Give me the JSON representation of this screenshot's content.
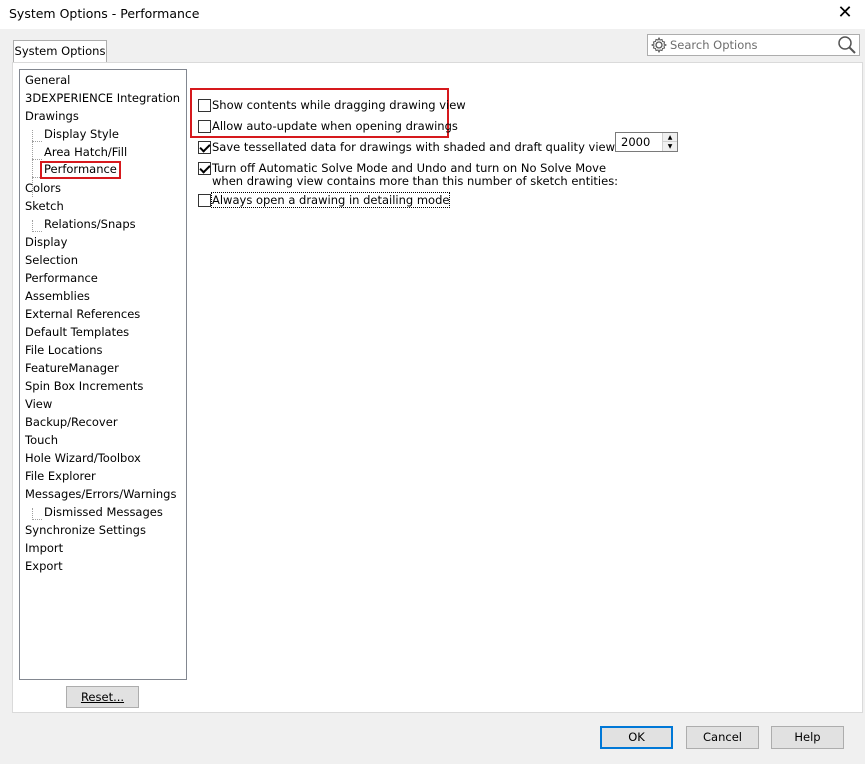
{
  "window": {
    "title": "System Options - Performance",
    "close_glyph": "✕"
  },
  "tab": {
    "label": "System Options"
  },
  "search": {
    "placeholder": "Search Options"
  },
  "tree": {
    "items": [
      {
        "label": "General",
        "level": 0
      },
      {
        "label": "3DEXPERIENCE Integration",
        "level": 0
      },
      {
        "label": "Drawings",
        "level": 0
      },
      {
        "label": "Display Style",
        "level": 1
      },
      {
        "label": "Area Hatch/Fill",
        "level": 1
      },
      {
        "label": "Performance",
        "level": 1,
        "selected": true
      },
      {
        "label": "Colors",
        "level": 0
      },
      {
        "label": "Sketch",
        "level": 0
      },
      {
        "label": "Relations/Snaps",
        "level": 1
      },
      {
        "label": "Display",
        "level": 0
      },
      {
        "label": "Selection",
        "level": 0
      },
      {
        "label": "Performance",
        "level": 0
      },
      {
        "label": "Assemblies",
        "level": 0
      },
      {
        "label": "External References",
        "level": 0
      },
      {
        "label": "Default Templates",
        "level": 0
      },
      {
        "label": "File Locations",
        "level": 0
      },
      {
        "label": "FeatureManager",
        "level": 0
      },
      {
        "label": "Spin Box Increments",
        "level": 0
      },
      {
        "label": "View",
        "level": 0
      },
      {
        "label": "Backup/Recover",
        "level": 0
      },
      {
        "label": "Touch",
        "level": 0
      },
      {
        "label": "Hole Wizard/Toolbox",
        "level": 0
      },
      {
        "label": "File Explorer",
        "level": 0
      },
      {
        "label": "Messages/Errors/Warnings",
        "level": 0
      },
      {
        "label": "Dismissed Messages",
        "level": 1
      },
      {
        "label": "Synchronize Settings",
        "level": 0
      },
      {
        "label": "Import",
        "level": 0
      },
      {
        "label": "Export",
        "level": 0
      }
    ],
    "reset_label": "Reset..."
  },
  "options": {
    "show_contents": {
      "label": "Show contents while dragging drawing view",
      "checked": false
    },
    "auto_update": {
      "label": "Allow auto-update when opening drawings",
      "checked": false
    },
    "save_tessellated": {
      "label": "Save tessellated data for drawings with shaded and draft quality views",
      "checked": true
    },
    "turn_off_solve": {
      "label_line1": "Turn off Automatic Solve Mode and Undo and turn on No Solve Move",
      "label_line2": "when drawing view contains more than this number of sketch entities:",
      "checked": true,
      "value": "2000"
    },
    "always_detailing": {
      "label": "Always open a drawing in detailing mode",
      "checked": false
    }
  },
  "buttons": {
    "ok": "OK",
    "cancel": "Cancel",
    "help": "Help"
  },
  "colors": {
    "highlight": "#d6191d",
    "default_button_border": "#0078d7"
  }
}
